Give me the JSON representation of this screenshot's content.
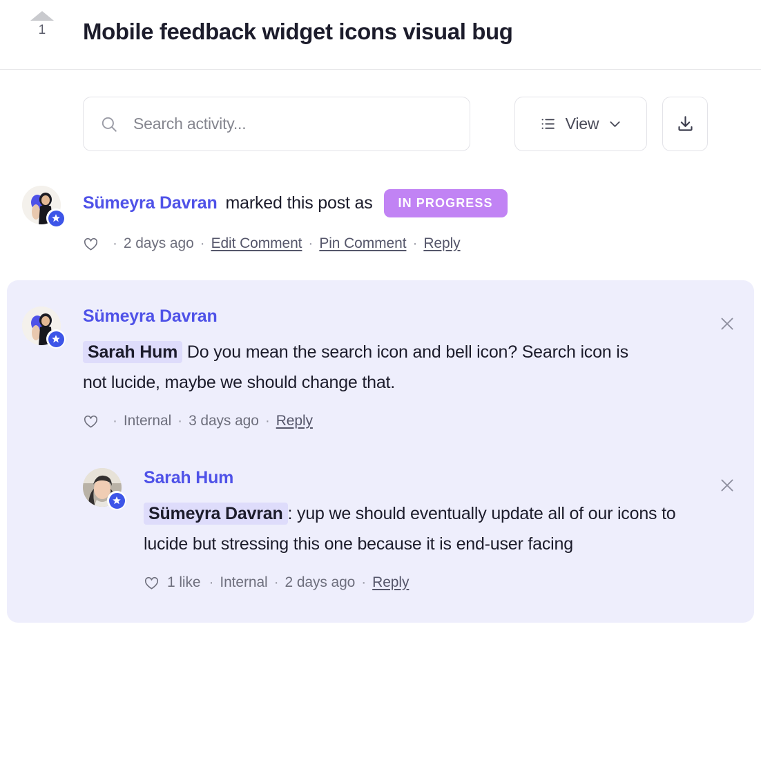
{
  "header": {
    "upvote_count": "1",
    "title": "Mobile feedback widget icons visual bug",
    "upvote_icon": "triangle-up-icon"
  },
  "toolbar": {
    "search_placeholder": "Search activity...",
    "search_value": "",
    "search_icon": "search-icon",
    "view_label": "View",
    "view_icon": "list-icon",
    "view_chevron_icon": "chevron-down-icon",
    "download_icon": "download-icon"
  },
  "colors": {
    "accent": "#4f52e8",
    "status_in_progress": "#c183f4",
    "panel_background": "#eeeefc",
    "mention_background": "#dedcfb"
  },
  "activity": [
    {
      "author": "Sümeyra Davran",
      "action_text": "marked this post as",
      "status_badge": "IN PROGRESS",
      "avatar_icon": "avatar-sumeyra",
      "badge_icon": "star-badge-icon",
      "meta": {
        "heart_icon": "heart-icon",
        "likes": "",
        "visibility": "",
        "timestamp": "2 days ago",
        "links": [
          "Edit Comment",
          "Pin Comment",
          "Reply"
        ]
      }
    }
  ],
  "thread": {
    "comments": [
      {
        "author": "Sümeyra Davran",
        "avatar_icon": "avatar-sumeyra",
        "badge_icon": "star-badge-icon",
        "close_icon": "close-icon",
        "mention": "Sarah Hum",
        "text": " Do you mean the search icon and bell icon? Search icon is not lucide, maybe we should change that.",
        "meta": {
          "heart_icon": "heart-icon",
          "likes": "",
          "visibility": "Internal",
          "timestamp": "3 days ago",
          "links": [
            "Reply"
          ]
        }
      },
      {
        "author": "Sarah Hum",
        "avatar_icon": "avatar-sarah",
        "badge_icon": "star-badge-icon",
        "close_icon": "close-icon",
        "mention": "Sümeyra Davran",
        "text": ": yup we should eventually update all of our icons to lucide but stressing this one because it is end-user facing",
        "meta": {
          "heart_icon": "heart-icon",
          "likes": "1 like",
          "visibility": "Internal",
          "timestamp": "2 days ago",
          "links": [
            "Reply"
          ]
        }
      }
    ]
  }
}
